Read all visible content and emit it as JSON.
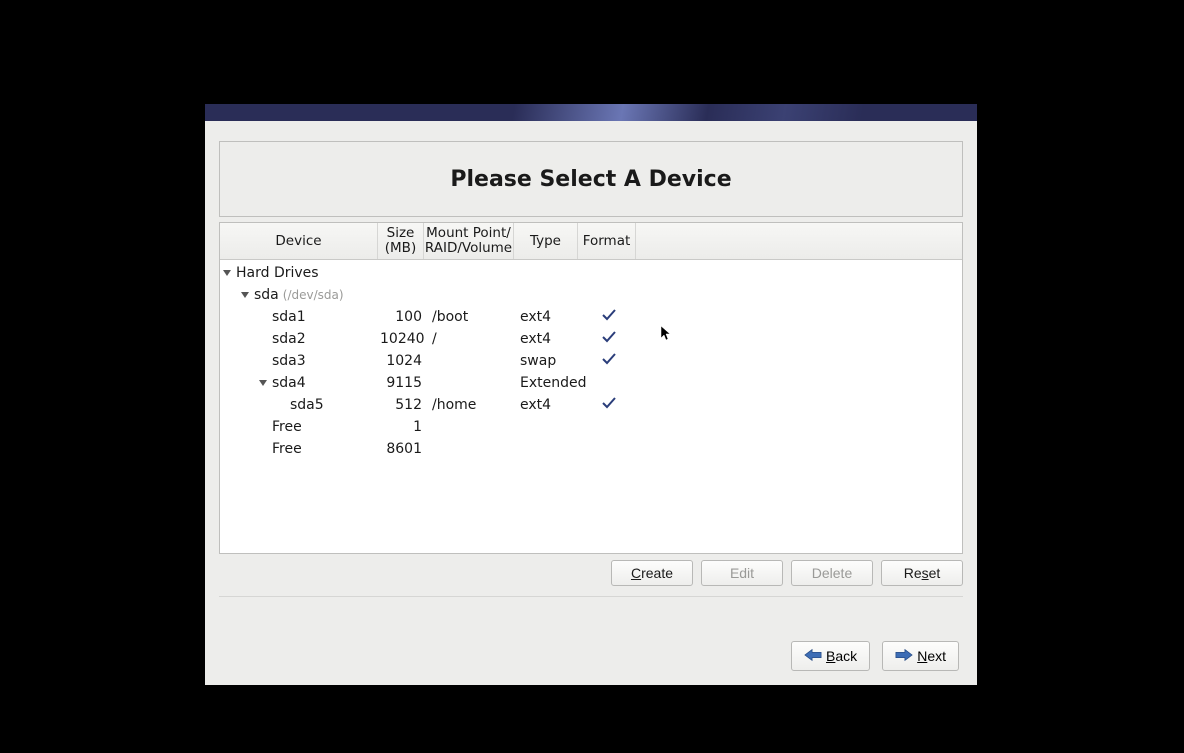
{
  "title": "Please Select A Device",
  "columns": {
    "device": "Device",
    "size": "Size\n(MB)",
    "mount": "Mount Point/\nRAID/Volume",
    "type": "Type",
    "format": "Format"
  },
  "tree": {
    "root_label": "Hard Drives",
    "disk": {
      "name": "sda",
      "path": "(/dev/sda)"
    }
  },
  "partitions": [
    {
      "indent": 2,
      "expander": false,
      "device": "sda1",
      "size": "100",
      "mount": "/boot",
      "type": "ext4",
      "format": true
    },
    {
      "indent": 2,
      "expander": false,
      "device": "sda2",
      "size": "10240",
      "mount": "/",
      "type": "ext4",
      "format": true
    },
    {
      "indent": 2,
      "expander": false,
      "device": "sda3",
      "size": "1024",
      "mount": "",
      "type": "swap",
      "format": true
    },
    {
      "indent": 2,
      "expander": true,
      "device": "sda4",
      "size": "9115",
      "mount": "",
      "type": "Extended",
      "format": false
    },
    {
      "indent": 3,
      "expander": false,
      "device": "sda5",
      "size": "512",
      "mount": "/home",
      "type": "ext4",
      "format": true
    },
    {
      "indent": 2,
      "expander": false,
      "device": "Free",
      "size": "1",
      "mount": "",
      "type": "",
      "format": false
    },
    {
      "indent": 2,
      "expander": false,
      "device": "Free",
      "size": "8601",
      "mount": "",
      "type": "",
      "format": false
    }
  ],
  "buttons": {
    "create": "Create",
    "edit": "Edit",
    "delete": "Delete",
    "reset": "Reset",
    "back": "Back",
    "next": "Next"
  }
}
